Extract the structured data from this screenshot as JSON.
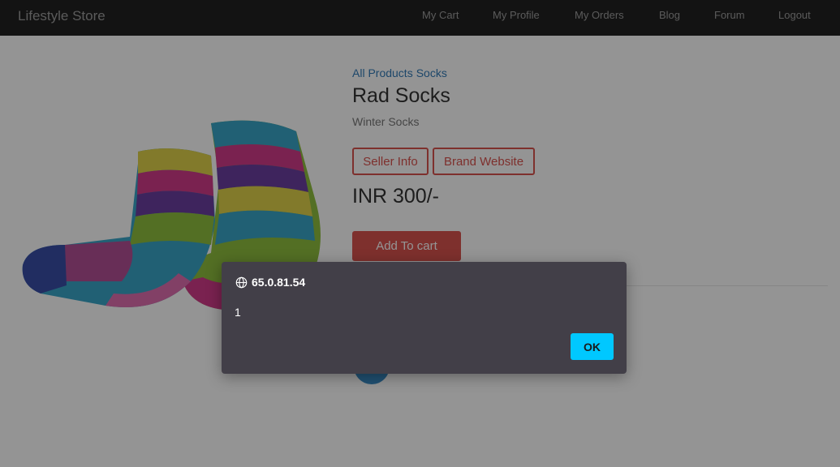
{
  "navbar": {
    "brand": "Lifestyle Store",
    "links": [
      "My Cart",
      "My Profile",
      "My Orders",
      "Blog",
      "Forum",
      "Logout"
    ]
  },
  "product": {
    "breadcrumb": [
      "All Products",
      "Socks"
    ],
    "name": "Rad Socks",
    "category": "Winter Socks",
    "seller_info_label": "Seller Info",
    "brand_website_label": "Brand Website",
    "price": "INR 300/-",
    "add_to_cart_label": "Add To cart"
  },
  "dialog": {
    "origin": "65.0.81.54",
    "message": "1",
    "ok_label": "OK"
  },
  "colors": {
    "navbar_bg": "#222222",
    "danger": "#d9534f",
    "link": "#337ab7",
    "dialog_bg": "#423f48",
    "ok_button": "#00c8ff"
  }
}
